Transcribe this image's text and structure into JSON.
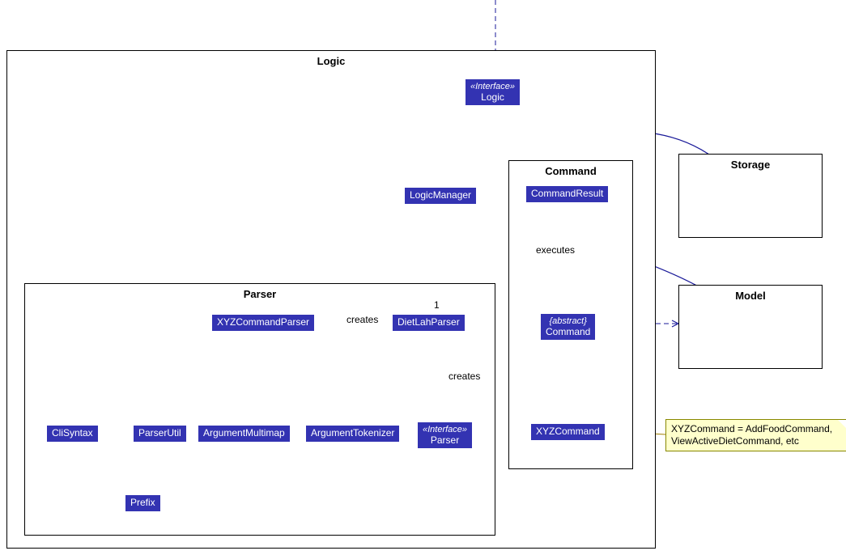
{
  "packages": {
    "logic": {
      "title": "Logic"
    },
    "command": {
      "title": "Command"
    },
    "parser": {
      "title": "Parser"
    },
    "storage": {
      "title": "Storage"
    },
    "model": {
      "title": "Model"
    }
  },
  "classes": {
    "logicInterface": {
      "stereo": "«Interface»",
      "name": "Logic"
    },
    "logicManager": {
      "name": "LogicManager"
    },
    "commandResult": {
      "name": "CommandResult"
    },
    "abstractCommand": {
      "stereo": "{abstract}",
      "name": "Command"
    },
    "xyzCommand": {
      "name": "XYZCommand"
    },
    "dietLahParser": {
      "name": "DietLahParser"
    },
    "xyzCommandParser": {
      "name": "XYZCommandParser"
    },
    "parserInterface": {
      "stereo": "«Interface»",
      "name": "Parser"
    },
    "argumentTokenizer": {
      "name": "ArgumentTokenizer"
    },
    "argumentMultimap": {
      "name": "ArgumentMultimap"
    },
    "parserUtil": {
      "name": "ParserUtil"
    },
    "cliSyntax": {
      "name": "CliSyntax"
    },
    "prefix": {
      "name": "Prefix"
    }
  },
  "labels": {
    "executes": "executes",
    "creates1": "creates",
    "creates2": "creates",
    "one": "1"
  },
  "note": {
    "line1": "XYZCommand = AddFoodCommand,",
    "line2": "ViewActiveDietCommand, etc"
  },
  "colors": {
    "classFill": "#3333b2",
    "line": "#1a1a99",
    "noteFill": "#ffffcc",
    "noteBorder": "#888800"
  }
}
